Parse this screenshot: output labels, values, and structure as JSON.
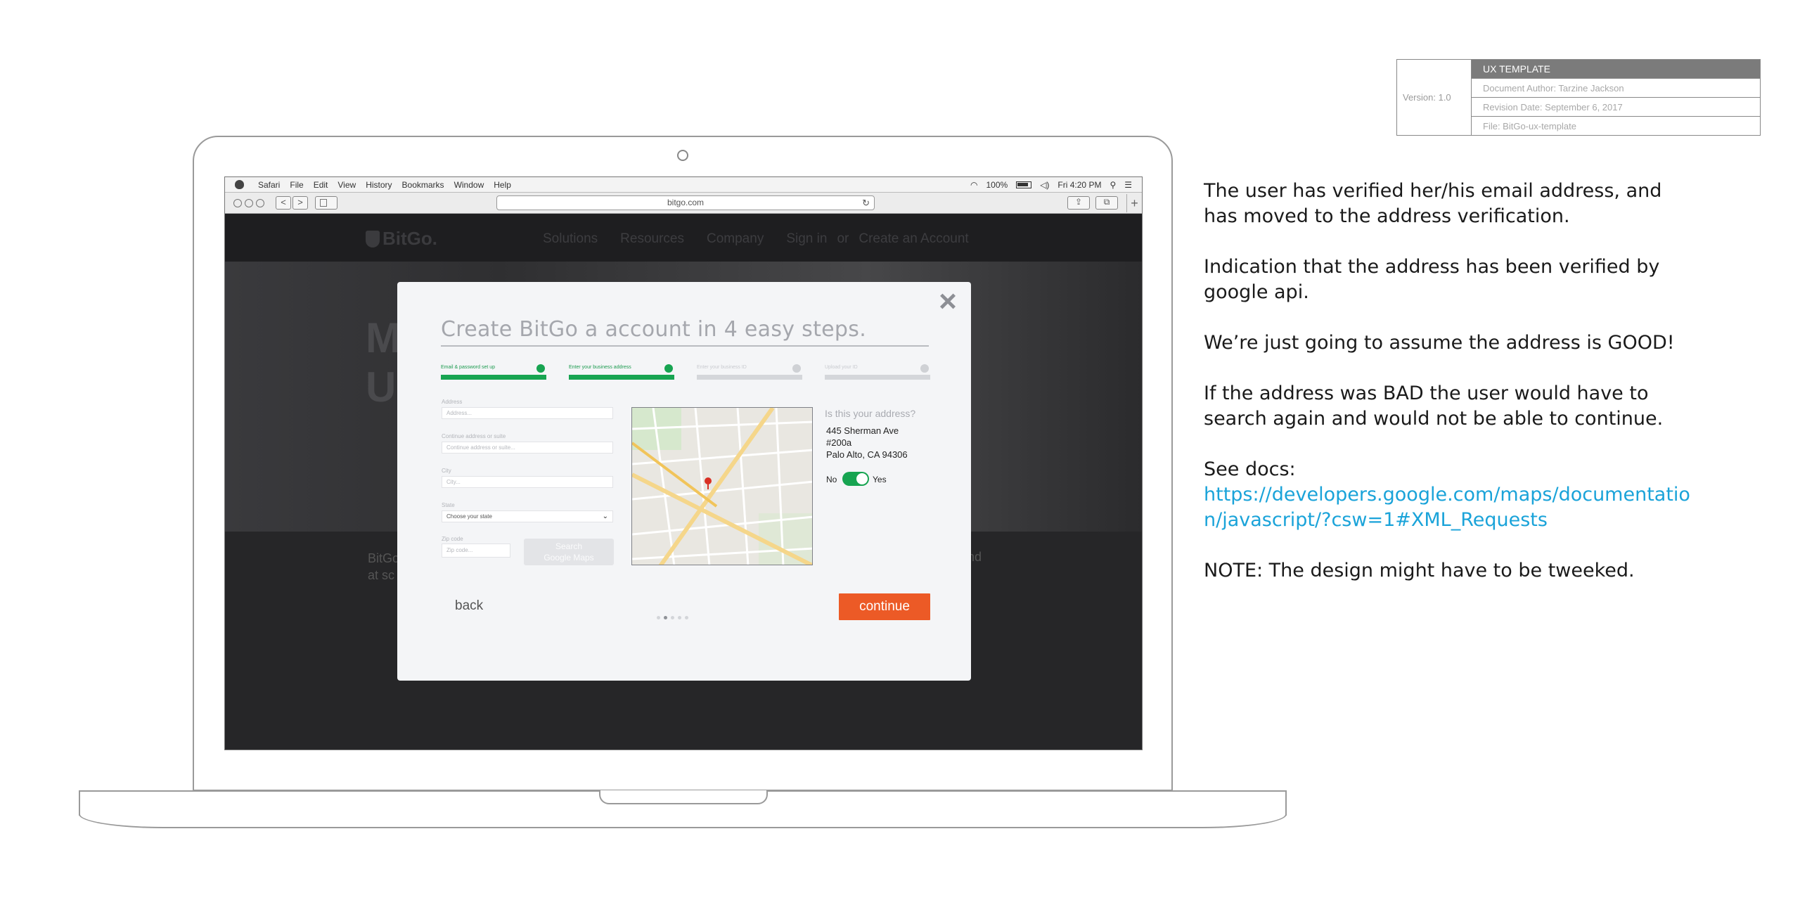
{
  "ux_template": {
    "version": "Version: 1.0",
    "header": "UX TEMPLATE",
    "author": "Document Author: Tarzine Jackson",
    "revision": "Revision Date: September 6, 2017",
    "file": "File: BitGo-ux-template"
  },
  "mac_menubar": {
    "items": [
      "Safari",
      "File",
      "Edit",
      "View",
      "History",
      "Bookmarks",
      "Window",
      "Help"
    ],
    "battery": "100%",
    "clock": "Fri 4:20 PM"
  },
  "browser": {
    "url": "bitgo.com",
    "back": "<",
    "forward": ">",
    "new_tab": "+"
  },
  "site": {
    "logo": "BitGo.",
    "nav": [
      "Solutions",
      "Resources",
      "Company"
    ],
    "sign_in": "Sign in",
    "or": "or",
    "create_account": "Create an Account",
    "hero_text_1": "M",
    "hero_text_2": "U",
    "below_left_1": "BitGo",
    "below_left_2": "at sc",
    "below_right": "and"
  },
  "modal": {
    "close": "×",
    "title": "Create BitGo a account in 4 easy steps.",
    "steps": [
      {
        "label": "Email & password set up",
        "done": true
      },
      {
        "label": "Enter your business address",
        "done": true
      },
      {
        "label": "Enter your business ID",
        "done": false
      },
      {
        "label": "Upload your ID",
        "done": false
      }
    ],
    "form": {
      "address_label": "Address",
      "address_placeholder": "Address...",
      "address2_label": "Continue address or suite",
      "address2_placeholder": "Continue address or suite...",
      "city_label": "City",
      "city_placeholder": "City...",
      "state_label": "State",
      "state_value": "Choose your state",
      "zip_label": "Zip code",
      "zip_placeholder": "Zip code...",
      "search_button_line1": "Search",
      "search_button_line2": "Google Maps"
    },
    "confirm": {
      "question": "Is this your address?",
      "line1": "445 Sherman Ave",
      "line2": "#200a",
      "line3": "Palo Alto, CA 94306",
      "toggle_no": "No",
      "toggle_yes": "Yes",
      "toggle_on": true
    },
    "back": "back",
    "continue": "continue",
    "pager_total": 5,
    "pager_active": 2
  },
  "notes": {
    "p1": "The user has verified her/his email address, and has moved to the address verification.",
    "p2": "Indication that the address has been verified by google api.",
    "p3": "We’re just going to assume the address is GOOD!",
    "p4": "If the address was BAD the user would have to search again and would not be able to continue.",
    "p5_label": "See docs:",
    "p5_link": "https://developers.google.com/maps/documentation/javascript/?csw=1#XML_Requests",
    "p6": "NOTE: The design might have to be tweeked."
  },
  "colors": {
    "accent_green": "#17a451",
    "accent_orange": "#ec5a26",
    "link_blue": "#1aa3d9"
  }
}
